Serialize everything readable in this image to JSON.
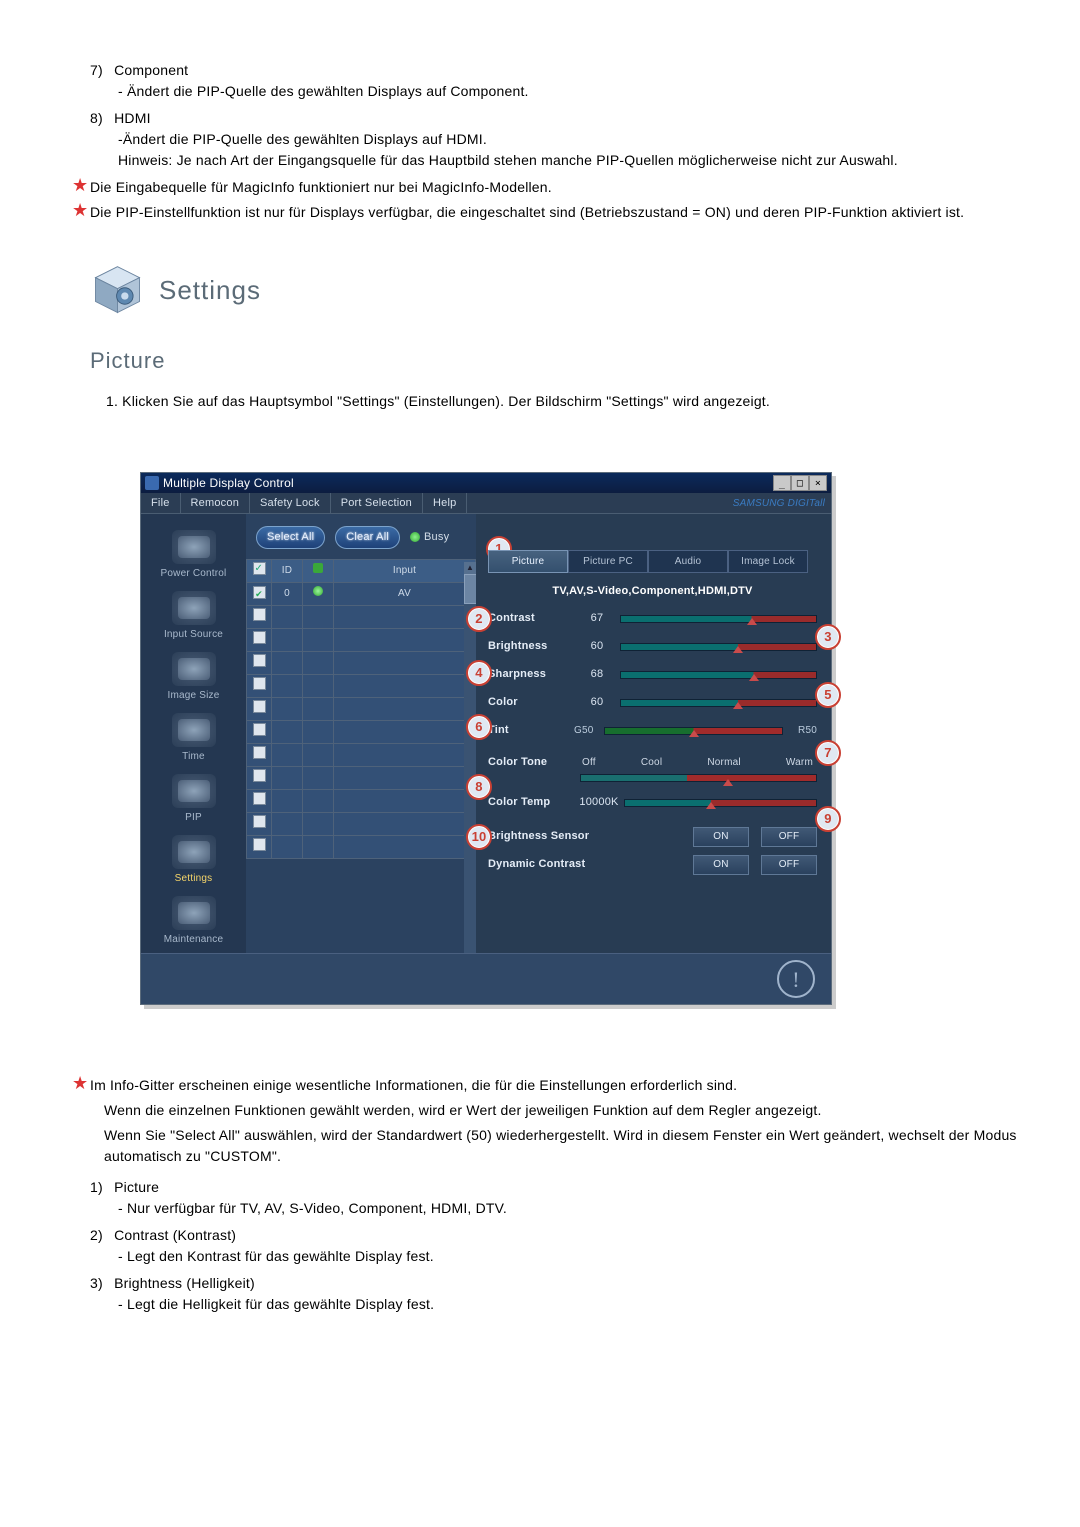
{
  "top_notes": {
    "item7": {
      "num": "7)",
      "label": "Component",
      "desc": "- Ändert die PIP-Quelle des gewählten Displays auf Component."
    },
    "item8": {
      "num": "8)",
      "label": "HDMI",
      "desc": "-Ändert die PIP-Quelle des gewählten Displays auf HDMI.",
      "hint": "Hinweis: Je nach Art der Eingangsquelle für das Hauptbild stehen manche PIP-Quellen möglicherweise nicht zur Auswahl."
    },
    "star1": "Die Eingabequelle für MagicInfo funktioniert nur bei MagicInfo-Modellen.",
    "star2": "Die PIP-Einstellfunktion ist nur für Displays verfügbar, die eingeschaltet sind (Betriebszustand = ON) und deren PIP-Funktion aktiviert ist."
  },
  "section": {
    "settings": "Settings",
    "picture": "Picture"
  },
  "intro": "1.  Klicken Sie auf das Hauptsymbol \"Settings\" (Einstellungen). Der Bildschirm \"Settings\" wird angezeigt.",
  "app": {
    "title": "Multiple Display Control",
    "menubar": [
      "File",
      "Remocon",
      "Safety Lock",
      "Port Selection",
      "Help"
    ],
    "brand": "SAMSUNG DIGITall",
    "sidebar": [
      {
        "label": "Power Control"
      },
      {
        "label": "Input Source"
      },
      {
        "label": "Image Size"
      },
      {
        "label": "Time"
      },
      {
        "label": "PIP"
      },
      {
        "label": "Settings",
        "selected": true
      },
      {
        "label": "Maintenance"
      }
    ],
    "buttons": {
      "select_all": "Select All",
      "clear_all": "Clear All",
      "busy": "Busy"
    },
    "grid": {
      "headers": {
        "id": "ID",
        "input": "Input"
      },
      "row": {
        "id": "0",
        "input": "AV"
      }
    },
    "tabs": [
      "Picture",
      "Picture PC",
      "Audio",
      "Image Lock"
    ],
    "subtitle": "TV,AV,S-Video,Component,HDMI,DTV",
    "controls": {
      "contrast": {
        "label": "Contrast",
        "value": "67"
      },
      "brightness": {
        "label": "Brightness",
        "value": "60"
      },
      "sharpness": {
        "label": "Sharpness",
        "value": "68"
      },
      "color": {
        "label": "Color",
        "value": "60"
      },
      "tint": {
        "label": "Tint",
        "left": "G50",
        "right": "R50"
      },
      "colortone": {
        "label": "Color Tone",
        "opts": [
          "Off",
          "Cool",
          "Normal",
          "Warm"
        ]
      },
      "colortemp": {
        "label": "Color Temp",
        "value": "10000K"
      },
      "bsensor": {
        "label": "Brightness Sensor",
        "on": "ON",
        "off": "OFF"
      },
      "dcontrast": {
        "label": "Dynamic Contrast",
        "on": "ON",
        "off": "OFF"
      }
    }
  },
  "lower": {
    "star": "Im Info-Gitter erscheinen einige wesentliche Informationen, die für die Einstellungen erforderlich sind.",
    "star_lines": [
      "Wenn die einzelnen Funktionen gewählt werden, wird er Wert der jeweiligen Funktion auf dem Regler angezeigt.",
      "Wenn Sie \"Select All\" auswählen, wird der Standardwert (50) wiederhergestellt. Wird in diesem Fenster ein Wert geändert, wechselt der Modus automatisch zu \"CUSTOM\"."
    ],
    "items": [
      {
        "num": "1)",
        "label": "Picture",
        "desc": "- Nur verfügbar für TV, AV, S-Video, Component, HDMI, DTV."
      },
      {
        "num": "2)",
        "label": "Contrast (Kontrast)",
        "desc": "- Legt den Kontrast für das gewählte Display fest."
      },
      {
        "num": "3)",
        "label": "Brightness (Helligkeit)",
        "desc": "- Legt die Helligkeit für das gewählte Display fest."
      }
    ]
  }
}
